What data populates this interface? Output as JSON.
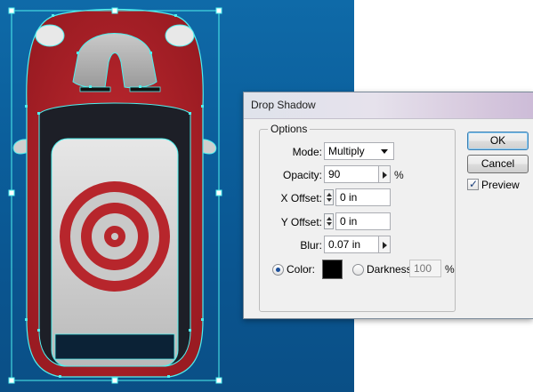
{
  "dialog": {
    "title": "Drop Shadow",
    "options_legend": "Options",
    "mode": {
      "label": "Mode:",
      "value": "Multiply"
    },
    "opacity": {
      "label": "Opacity:",
      "value": "90",
      "unit": "%"
    },
    "x_offset": {
      "label": "X Offset:",
      "value": "0 in"
    },
    "y_offset": {
      "label": "Y Offset:",
      "value": "0 in"
    },
    "blur": {
      "label": "Blur:",
      "value": "0.07 in"
    },
    "color": {
      "label": "Color:",
      "selected": true,
      "swatch": "#000000"
    },
    "darkness": {
      "label": "Darkness:",
      "value": "100",
      "unit": "%",
      "selected": false
    },
    "ok_label": "OK",
    "cancel_label": "Cancel",
    "preview": {
      "label": "Preview",
      "checked": true
    }
  },
  "artboard": {
    "background_color": "#0b5f9c",
    "car_body_color": "#b7262c",
    "roof_color": "#d3d3d3",
    "target_color": "#b7262c",
    "selection_color": "#4ff0ee"
  }
}
